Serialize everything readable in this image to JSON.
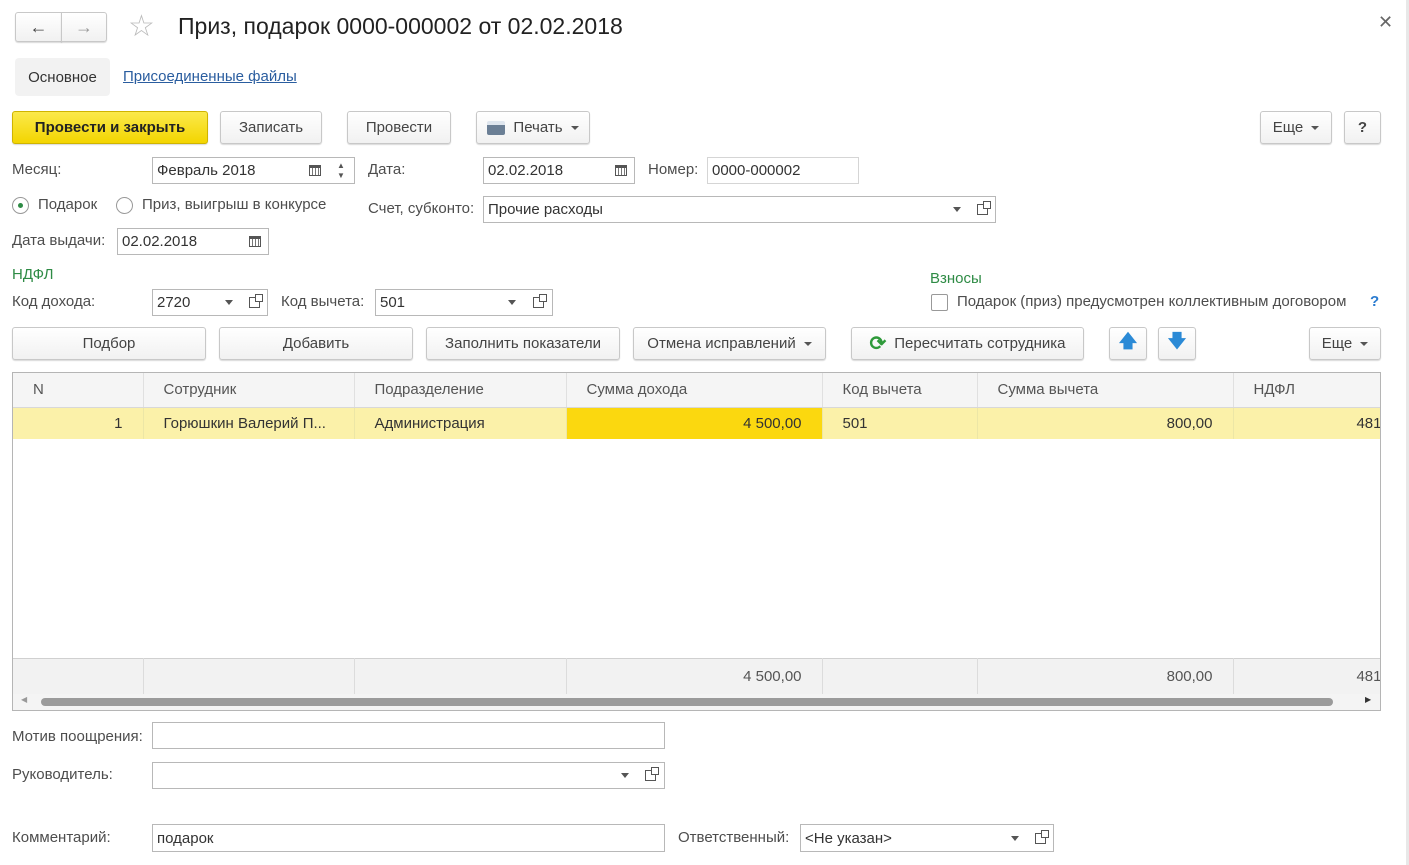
{
  "window": {
    "title": "Приз, подарок 0000-000002 от 02.02.2018",
    "tabs": [
      "Основное",
      "Присоединенные файлы"
    ]
  },
  "toolbar": {
    "post_close": "Провести и закрыть",
    "save": "Записать",
    "post": "Провести",
    "print": "Печать",
    "more": "Еще",
    "help": "?"
  },
  "form": {
    "month_label": "Месяц:",
    "month_value": "Февраль 2018",
    "date_label": "Дата:",
    "date_value": "02.02.2018",
    "number_label": "Номер:",
    "number_value": "0000-000002",
    "radio_gift": "Подарок",
    "radio_prize": "Приз, выигрыш в конкурсе",
    "account_label": "Счет, субконто:",
    "account_value": "Прочие расходы",
    "issue_date_label": "Дата выдачи:",
    "issue_date_value": "02.02.2018",
    "ndfl_header": "НДФЛ",
    "income_code_label": "Код дохода:",
    "income_code_value": "2720",
    "deduction_code_label": "Код вычета:",
    "deduction_code_value": "501",
    "contrib_header": "Взносы",
    "contrib_checkbox": "Подарок (приз) предусмотрен коллективным договором",
    "contrib_help": "?"
  },
  "table_toolbar": {
    "select": "Подбор",
    "add": "Добавить",
    "fill": "Заполнить показатели",
    "cancel_fix": "Отмена исправлений",
    "recalc": "Пересчитать сотрудника",
    "more": "Еще"
  },
  "table": {
    "columns": [
      "N",
      "Сотрудник",
      "Подразделение",
      "Сумма дохода",
      "Код вычета",
      "Сумма вычета",
      "НДФЛ"
    ],
    "rows": [
      [
        "1",
        "Горюшкин Валерий П...",
        "Администрация",
        "4 500,00",
        "501",
        "800,00",
        "481"
      ]
    ],
    "totals": [
      "",
      "",
      "",
      "4 500,00",
      "",
      "800,00",
      "481"
    ]
  },
  "bottom": {
    "motive_label": "Мотив поощрения:",
    "motive_value": "",
    "manager_label": "Руководитель:",
    "manager_value": "",
    "comment_label": "Комментарий:",
    "comment_value": "подарок",
    "responsible_label": "Ответственный:",
    "responsible_value": "<Не указан>"
  },
  "colors": {
    "accent_yellow": "#f3d500",
    "selected_row": "#fbf1a9",
    "selected_cell": "#fbd80f",
    "section_green": "#2e8b45",
    "arrow_blue": "#2b8ad6"
  }
}
